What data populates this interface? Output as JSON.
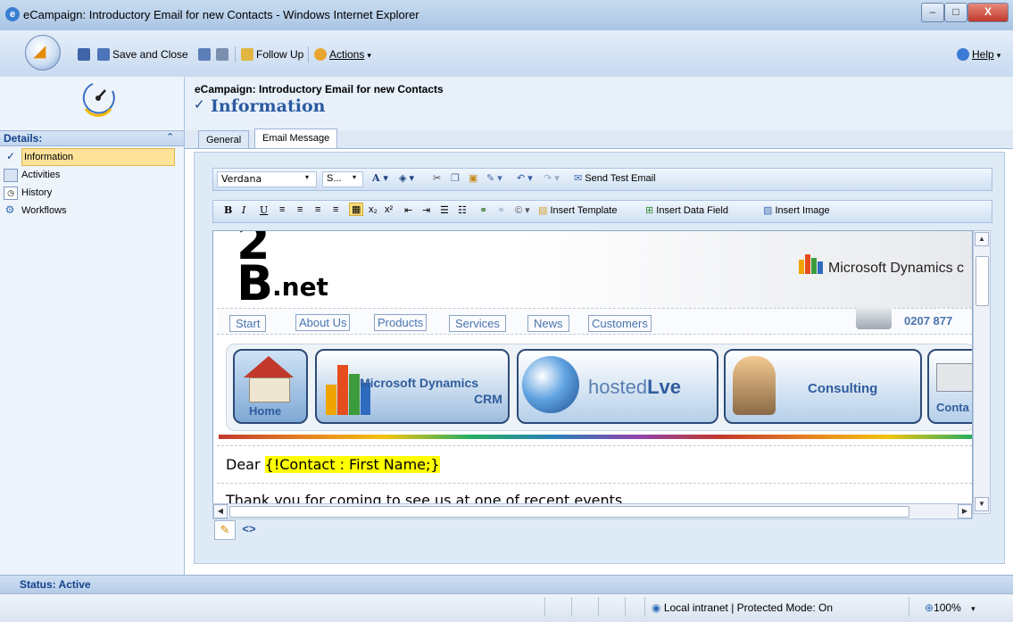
{
  "window": {
    "title": "eCampaign: Introductory Email for new Contacts - Windows Internet Explorer",
    "minimize": "–",
    "maximize": "□",
    "close": "X"
  },
  "toolbar": {
    "save_close": "Save and Close",
    "follow_up": "Follow Up",
    "actions": "Actions",
    "help": "Help"
  },
  "record": {
    "breadcrumb": "eCampaign: Introductory Email for new Contacts",
    "section_title": "Information"
  },
  "nav": {
    "header": "Details:",
    "items": [
      {
        "label": "Information",
        "icon": "information-icon"
      },
      {
        "label": "Activities",
        "icon": "activities-icon"
      },
      {
        "label": "History",
        "icon": "history-icon"
      },
      {
        "label": "Workflows",
        "icon": "workflows-icon"
      }
    ]
  },
  "tabs": [
    {
      "label": "General"
    },
    {
      "label": "Email Message"
    }
  ],
  "editor": {
    "font": "Verdana",
    "size": "S...",
    "send_test": "Send Test Email",
    "insert_template": "Insert Template",
    "insert_data_field": "Insert Data Field",
    "insert_image": "Insert Image"
  },
  "email": {
    "logo_number": "2",
    "logo_b": "B",
    "logo_suffix": ".net",
    "brand": "Microsoft Dynamics c",
    "phone": "0207 877",
    "menu": [
      "Start",
      "About Us",
      "Products",
      "Services",
      "News",
      "Customers"
    ],
    "banners": {
      "home": "Home",
      "crm_line1": "Microsoft Dynamics",
      "crm_line2": "CRM",
      "hosted": "hosted",
      "live": "Lve",
      "consulting": "Consulting",
      "contact": "Conta"
    },
    "greeting": "Dear",
    "merge_field": "{!Contact : First Name;}",
    "body": "Thank you for coming to see us at one of recent events"
  },
  "status": {
    "label": "Status: Active"
  },
  "ie_status": {
    "zone": "Local intranet | Protected Mode: On",
    "zoom": "100%"
  },
  "colors": {
    "accent": "#15428b",
    "merge_highlight": "#ffff00",
    "selected_nav": "#fde39a"
  }
}
